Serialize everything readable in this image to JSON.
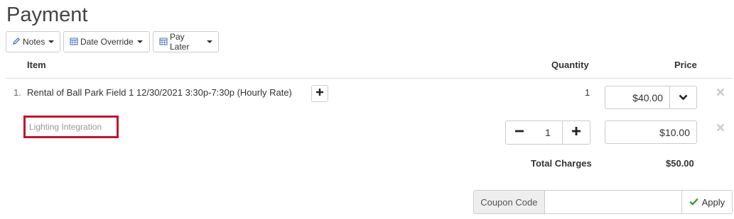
{
  "page": {
    "title": "Payment"
  },
  "toolbar": {
    "notes_label": "Notes",
    "date_override_label": "Date Override",
    "pay_later_label": "Pay Later"
  },
  "table": {
    "headers": {
      "item": "Item",
      "quantity": "Quantity",
      "price": "Price"
    },
    "rows": [
      {
        "index": "1.",
        "description": "Rental of Ball Park Field 1 12/30/2021 3:30p-7:30p (Hourly Rate)",
        "quantity": "1",
        "price": "$40.00"
      }
    ],
    "addon": {
      "placeholder": "Lighting Integration",
      "quantity": "1",
      "price": "$10.00"
    },
    "total_label": "Total Charges",
    "total_value": "$50.00"
  },
  "coupon": {
    "label": "Coupon Code",
    "value": "",
    "apply_label": "Apply"
  },
  "colors": {
    "highlight": "#c0152f",
    "check": "#3c9a3c",
    "remove": "#cccccc"
  },
  "icons": [
    "pencil-icon",
    "calendar-icon",
    "plus-icon",
    "minus-icon",
    "chevron-down-icon",
    "close-icon",
    "checkmark-icon"
  ]
}
